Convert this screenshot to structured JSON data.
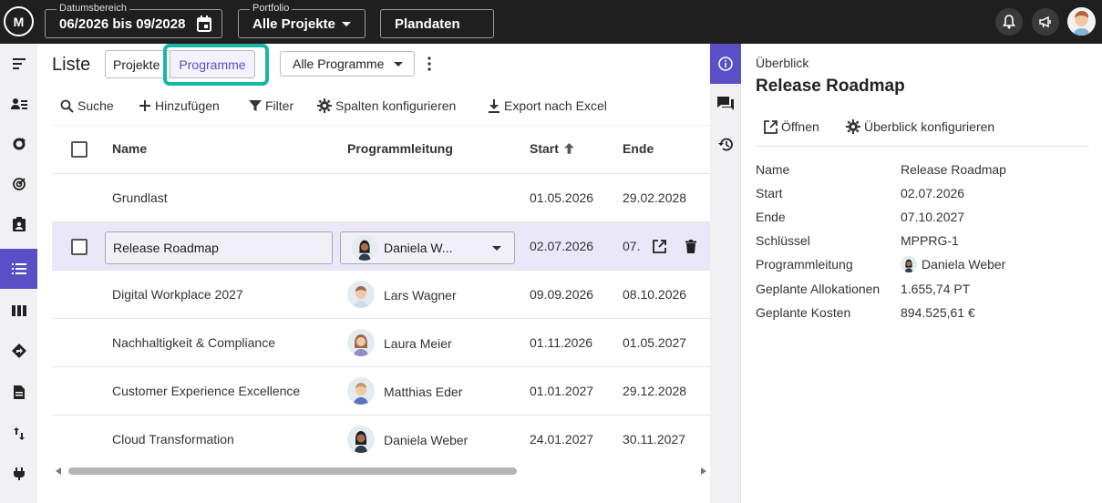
{
  "topbar": {
    "logo": "M",
    "date_range": {
      "legend": "Datumsbereich",
      "value": "06/2026 bis 09/2028"
    },
    "portfolio": {
      "legend": "Portfolio",
      "value": "Alle Projekte"
    },
    "plandaten": {
      "label": "Plandaten"
    }
  },
  "leftnav": {
    "items": [
      "menu-icon",
      "user-list-icon",
      "cycle-icon",
      "target-icon",
      "clipboard-user-icon",
      "list-icon",
      "columns-icon",
      "diamond-arrow-icon",
      "document-icon",
      "transfer-icon",
      "plug-icon"
    ],
    "active_index": 5
  },
  "main": {
    "title": "Liste",
    "tabs": [
      {
        "label": "Projekte"
      },
      {
        "label": "Programme"
      }
    ],
    "filter_dropdown": "Alle Programme",
    "toolbar": {
      "search": "Suche",
      "add": "Hinzufügen",
      "filter": "Filter",
      "columns": "Spalten konfigurieren",
      "export": "Export nach Excel"
    },
    "table": {
      "headers": {
        "name": "Name",
        "lead": "Programmleitung",
        "start": "Start",
        "end": "Ende"
      },
      "rows": [
        {
          "name": "Grundlast",
          "lead": "",
          "start": "01.05.2026",
          "end": "29.02.2028"
        },
        {
          "name": "Release Roadmap",
          "lead": "Daniela W...",
          "start": "02.07.2026",
          "end": "07."
        },
        {
          "name": "Digital Workplace 2027",
          "lead": "Lars Wagner",
          "start": "09.09.2026",
          "end": "08.10.2026"
        },
        {
          "name": "Nachhaltigkeit & Compliance",
          "lead": "Laura Meier",
          "start": "01.11.2026",
          "end": "01.05.2027"
        },
        {
          "name": "Customer Experience Excellence",
          "lead": "Matthias Eder",
          "start": "01.01.2027",
          "end": "29.12.2028"
        },
        {
          "name": "Cloud Transformation",
          "lead": "Daniela Weber",
          "start": "24.01.2027",
          "end": "30.11.2027"
        }
      ]
    }
  },
  "panel": {
    "kicker": "Überblick",
    "title": "Release Roadmap",
    "open": "Öffnen",
    "configure": "Überblick konfigurieren",
    "details": [
      {
        "key": "Name",
        "value": "Release Roadmap"
      },
      {
        "key": "Start",
        "value": "02.07.2026"
      },
      {
        "key": "Ende",
        "value": "07.10.2027"
      },
      {
        "key": "Schlüssel",
        "value": "MPPRG-1"
      },
      {
        "key": "Programmleitung",
        "value": "Daniela Weber"
      },
      {
        "key": "Geplante Allokationen",
        "value": "1.655,74 PT"
      },
      {
        "key": "Geplante Kosten",
        "value": "894.525,61 €"
      }
    ]
  },
  "colors": {
    "accent": "#5b4fc7",
    "highlight": "#19b7a6",
    "topbar": "#1f1f1f"
  }
}
